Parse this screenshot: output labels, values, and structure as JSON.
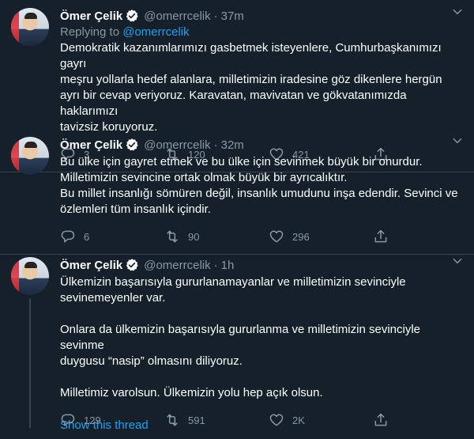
{
  "colors": {
    "background": "#15202b",
    "accent": "#1da1f2",
    "muted": "#8899a6",
    "divider": "#38444d"
  },
  "tweets": [
    {
      "name": "Ömer Çelik",
      "handle": "@omerrcelik",
      "time": "37m",
      "replying_label": "Replying to",
      "replying_to": "@omerrcelik",
      "lines": [
        "Demokratik kazanımlarımızı gasbetmek isteyenlere, Cumhurbaşkanımızı gayrı",
        "meşru yollarla hedef alanlara, milletimizin iradesine göz dikenlere hergün",
        "ayrı bir cevap veriyoruz. Karavatan, mavivatan ve gökvatanımızda haklarımızı",
        "tavizsiz koruyoruz."
      ],
      "replies": "3",
      "retweets": "120",
      "likes": "421"
    },
    {
      "name": "Ömer Çelik",
      "handle": "@omerrcelik",
      "time": "32m",
      "lines": [
        "Bu ülke için gayret etmek ve bu ülke için sevinmek büyük bir onurdur.",
        "Milletimizin sevincine ortak olmak büyük bir ayrıcalıktır.",
        "Bu millet insanlığı sömüren değil, insanlık umudunu inşa edendir. Sevinci ve",
        "özlemleri tüm insanlık içindir."
      ],
      "replies": "6",
      "retweets": "90",
      "likes": "296"
    },
    {
      "name": "Ömer Çelik",
      "handle": "@omerrcelik",
      "time": "1h",
      "lines": [
        "Ülkemizin başarısıyla gururlanamayanlar ve milletimizin sevinciyle",
        "sevinemeyenler var.",
        "",
        "Onlara da ülkemizin başarısıyla gururlanma ve milletimizin sevinciyle sevinme",
        "duygusu “nasip” olmasını diliyoruz.",
        "",
        "Milletimiz varolsun. Ülkemizin yolu hep açık olsun."
      ],
      "replies": "129",
      "retweets": "591",
      "likes": "2K"
    }
  ],
  "show_thread_label": "Show this thread",
  "icons": {
    "verified": "verified-badge-icon",
    "caret": "chevron-down-icon",
    "reply": "reply-icon",
    "retweet": "retweet-icon",
    "like": "heart-icon",
    "share": "share-icon"
  }
}
